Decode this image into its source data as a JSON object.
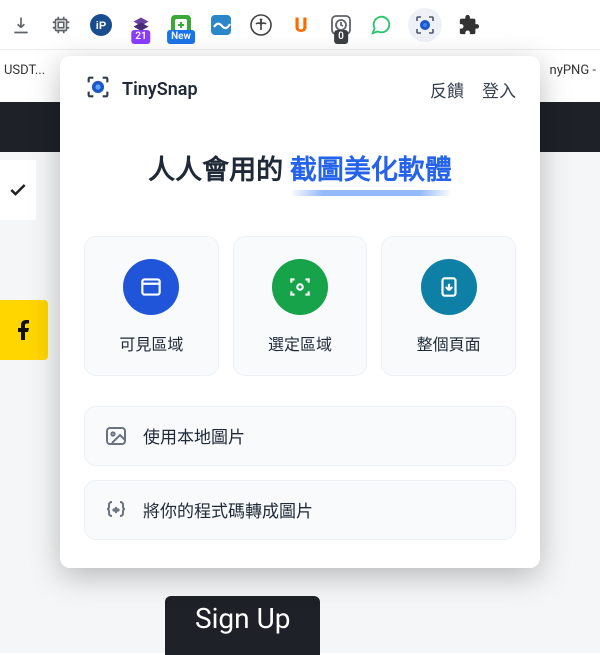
{
  "background": {
    "bookmark_left": "USDT...",
    "bookmark_right": "nyPNG -",
    "signup_text": "Sign Up"
  },
  "toolbar": {
    "badges": {
      "purple": "21",
      "blue": "New",
      "dark": "0"
    },
    "u_letter": "U"
  },
  "popup": {
    "brand": "TinySnap",
    "header_links": {
      "feedback": "反饋",
      "login": "登入"
    },
    "headline": {
      "plain": "人人會用的 ",
      "accent": "截圖美化軟體"
    },
    "actions": {
      "visible": "可見區域",
      "select": "選定區域",
      "full": "整個頁面"
    },
    "list": {
      "local_image": "使用本地圖片",
      "code_image": "將你的程式碼轉成圖片"
    }
  }
}
